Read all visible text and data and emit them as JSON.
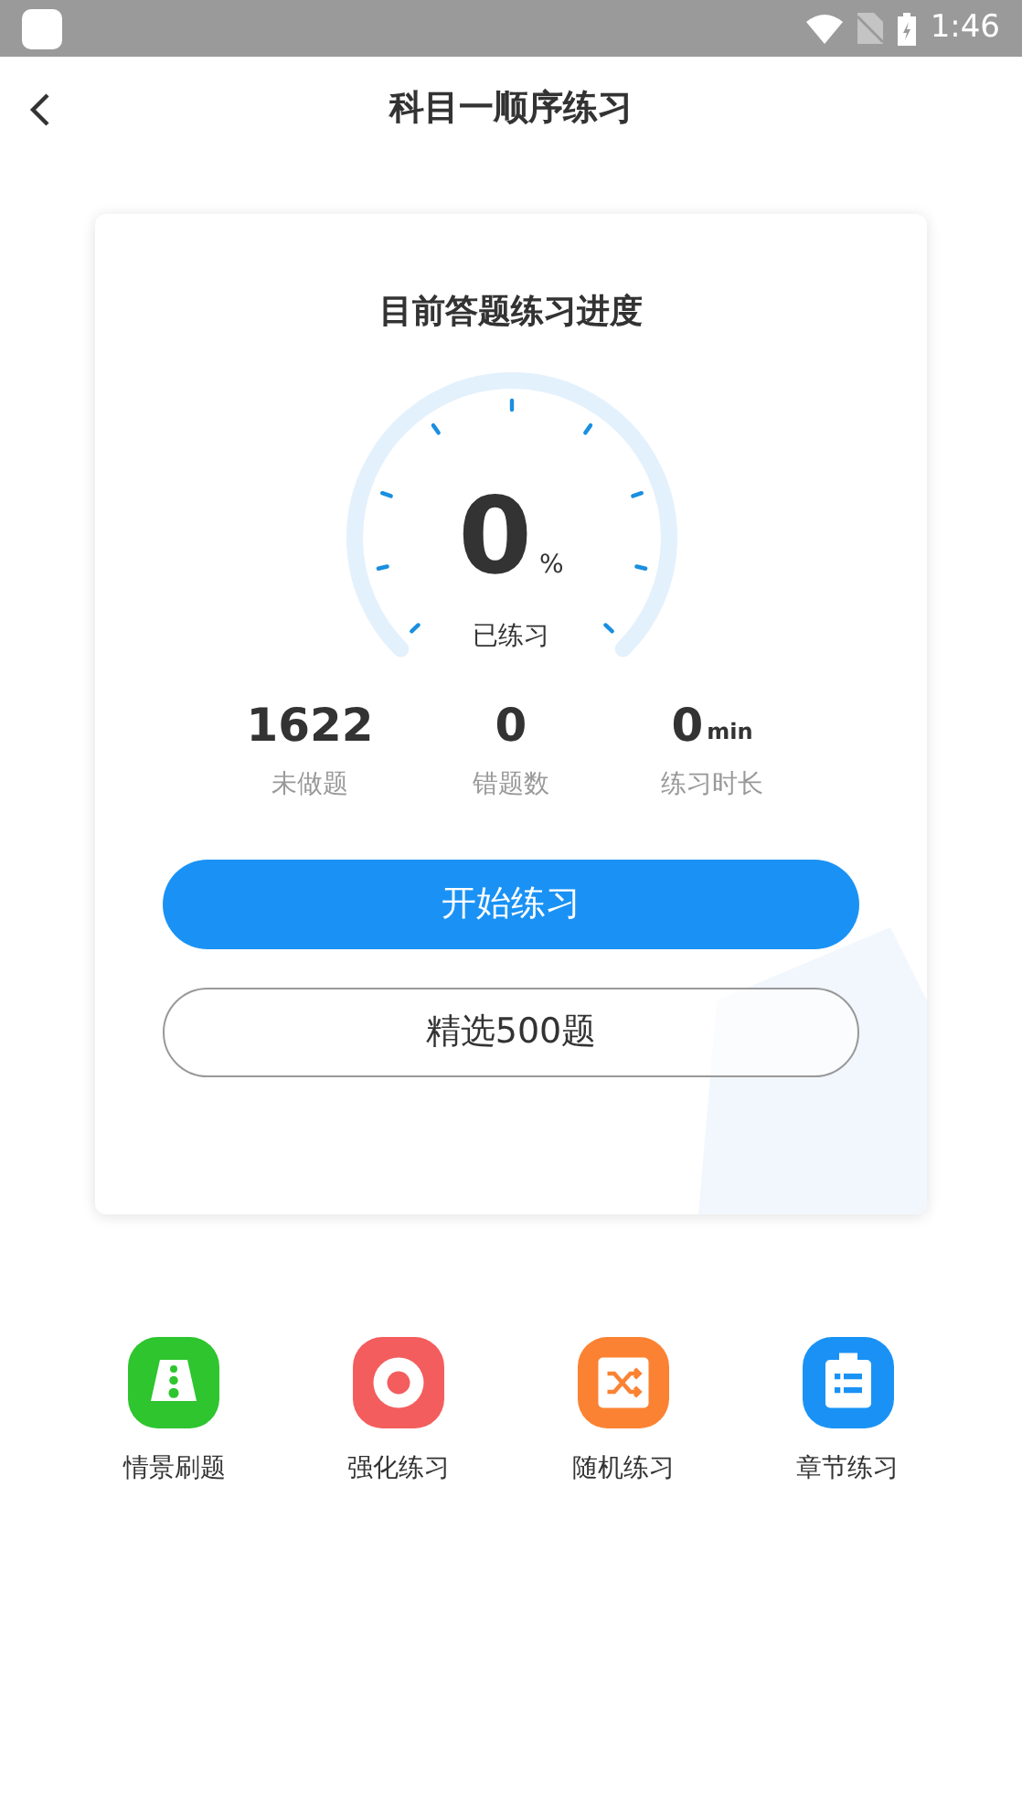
{
  "status_bar": {
    "time": "1:46"
  },
  "header": {
    "title": "科目一顺序练习"
  },
  "progress_card": {
    "title": "目前答题练习进度",
    "gauge": {
      "value": "0",
      "unit": "%",
      "caption": "已练习"
    },
    "stats": [
      {
        "value": "1622",
        "label": "未做题"
      },
      {
        "value": "0",
        "label": "错题数"
      },
      {
        "value": "0",
        "unit": "min",
        "label": "练习时长"
      }
    ],
    "buttons": [
      {
        "label": "开始练习",
        "kind": "primary"
      },
      {
        "label": "精选500题",
        "kind": "outline"
      }
    ]
  },
  "shortcuts": [
    {
      "label": "情景刷题",
      "kind": "road",
      "color": "#2ec52e"
    },
    {
      "label": "强化练习",
      "kind": "target",
      "color": "#f45d5d"
    },
    {
      "label": "随机练习",
      "kind": "shuffle",
      "color": "#fb8233"
    },
    {
      "label": "章节练习",
      "kind": "clipboard",
      "color": "#1a92f5"
    }
  ]
}
